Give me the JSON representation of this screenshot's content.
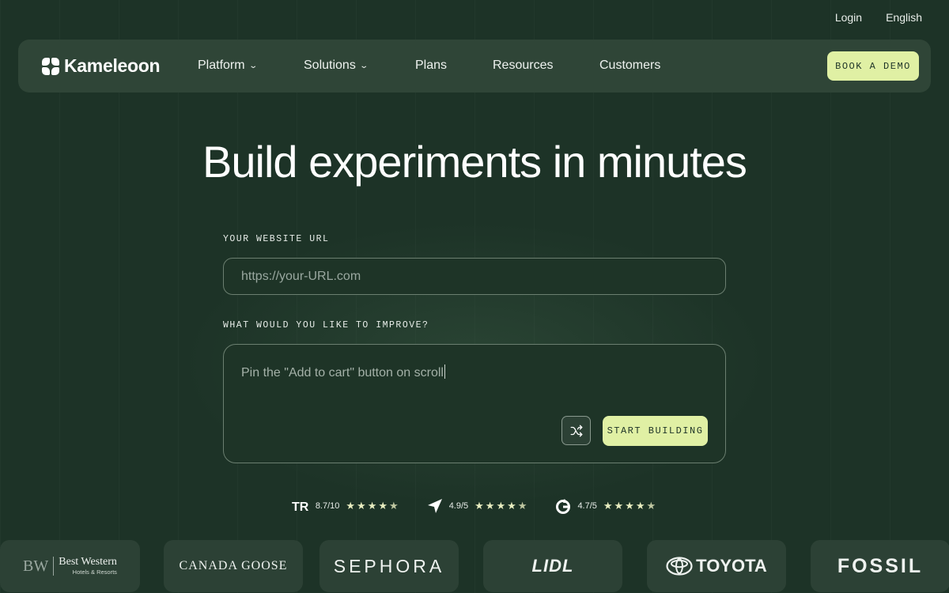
{
  "topbar": {
    "login": "Login",
    "language": "English"
  },
  "brand": {
    "name": "Kameleoon"
  },
  "nav": [
    {
      "label": "Platform",
      "dropdown": true
    },
    {
      "label": "Solutions",
      "dropdown": true
    },
    {
      "label": "Plans",
      "dropdown": false
    },
    {
      "label": "Resources",
      "dropdown": false
    },
    {
      "label": "Customers",
      "dropdown": false
    }
  ],
  "cta": {
    "book_demo": "BOOK A DEMO"
  },
  "hero": {
    "title": "Build experiments in minutes"
  },
  "form": {
    "url_label": "YOUR WEBSITE URL",
    "url_placeholder": "https://your-URL.com",
    "improve_label": "WHAT WOULD YOU LIKE TO IMPROVE?",
    "improve_text": "Pin the \"Add to cart\" button on scroll",
    "shuffle_icon": "shuffle-icon",
    "start_button": "START BUILDING"
  },
  "ratings": [
    {
      "icon": "trustradius-icon",
      "score": "8.7/10",
      "stars": 4.5
    },
    {
      "icon": "capterra-icon",
      "score": "4.9/5",
      "stars": 4.5
    },
    {
      "icon": "g2-icon",
      "score": "4.7/5",
      "stars": 4.5
    }
  ],
  "customer_logos": {
    "best_western": {
      "mark": "BW",
      "name": "Best Western",
      "sub": "Hotels & Resorts"
    },
    "canada_goose": "CANADA GOOSE",
    "sephora": "SEPHORA",
    "lidl": "LIDL",
    "toyota": "TOYOTA",
    "fossil": "FOSSIL"
  },
  "colors": {
    "background": "#1d3327",
    "navbar": "#2f4537",
    "accent": "#e0f0a4"
  }
}
